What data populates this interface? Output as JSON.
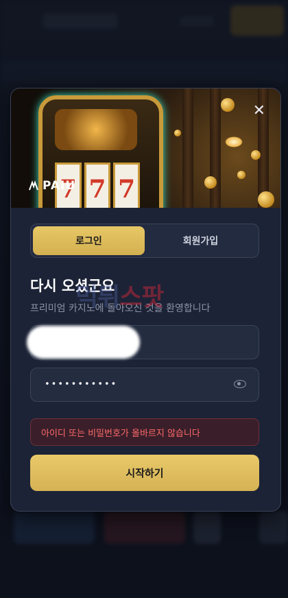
{
  "modal": {
    "brand": "PAIU",
    "close": "✕",
    "tabs": [
      {
        "label": "로그인",
        "active": true
      },
      {
        "label": "회원가입",
        "active": false
      }
    ],
    "reels": [
      "7",
      "7",
      "7"
    ],
    "welcome_title": "다시 오셨군요",
    "welcome_sub": "프리미엄 카지노에 돌아오신 것을 환영합니다",
    "password_mask": "•••••••••••",
    "error": "아이디 또는 비밀번호가 올바르지 않습니다",
    "submit": "시작하기"
  },
  "watermark": {
    "prefix": "먹튀",
    "text": "스팟"
  },
  "colors": {
    "accent_gold": "#e0c05e",
    "error": "#ff6a6a",
    "panel": "#1c2336"
  },
  "icons": [
    "close-icon",
    "eye-icon",
    "brand-logo-icon"
  ]
}
